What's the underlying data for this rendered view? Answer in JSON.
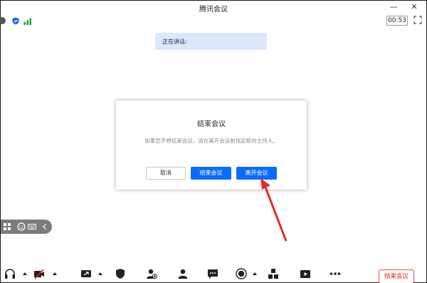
{
  "window": {
    "title": "腾讯会议",
    "minimize_glyph": "—",
    "close_glyph": "✕"
  },
  "info_bar": {
    "timer": "00:53",
    "icons": [
      "info-icon",
      "shield-icon",
      "signal-icon",
      "fullscreen-icon"
    ]
  },
  "speaking": {
    "label": "正在讲话:"
  },
  "dialog": {
    "title": "结束会议",
    "message": "如果您不想结束会议，请在离开会议前指定新的主持人。",
    "buttons": {
      "cancel": "取消",
      "end": "结束会议",
      "leave": "离开会议"
    }
  },
  "float_toolbar": {
    "icons": [
      "grid-layout-icon",
      "emoji-icon",
      "keyboard-icon",
      "collapse-arrow-icon"
    ]
  },
  "bottom_toolbar": {
    "items": [
      "headset-icon",
      "camera-off-icon",
      "share-screen-icon",
      "security-icon",
      "invite-icon",
      "members-icon",
      "chat-icon",
      "record-icon",
      "apps-icon",
      "video-icon",
      "more-icon"
    ],
    "end_meeting_label": "结束会议"
  },
  "colors": {
    "accent": "#0a6cff",
    "speaking_bg": "#dbe8fb",
    "danger": "#e02020",
    "arrow": "#e52b2b"
  }
}
